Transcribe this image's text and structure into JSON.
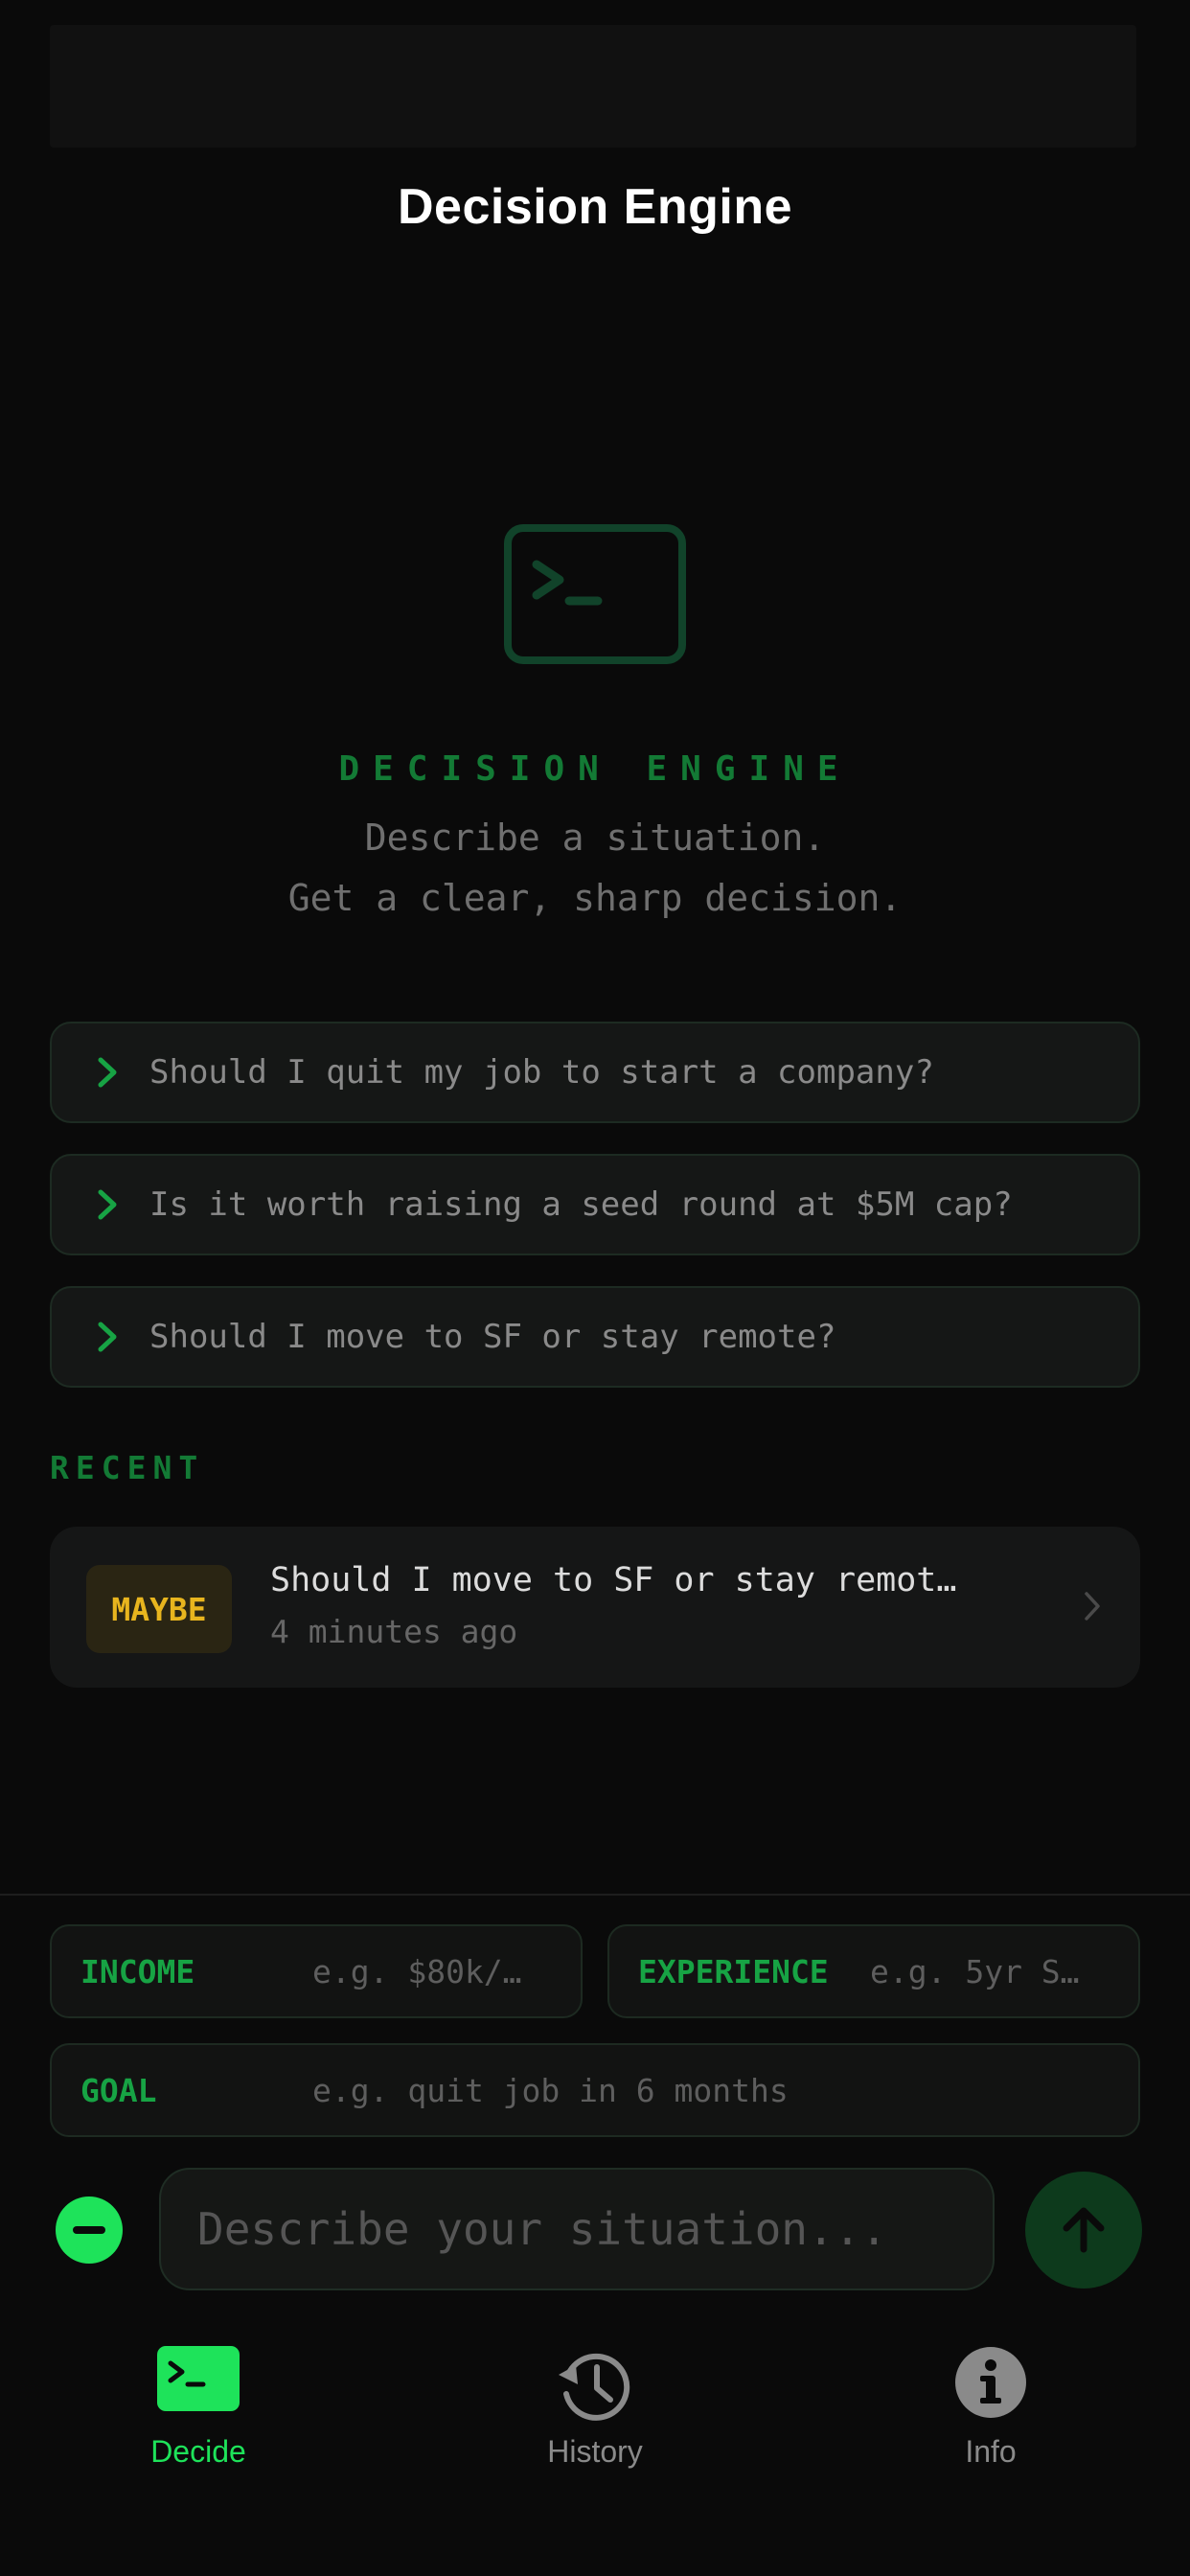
{
  "header": {
    "title": "Decision Engine"
  },
  "hero": {
    "icon": "terminal-icon",
    "heading": "DECISION ENGINE",
    "subtitle_line1": "Describe a situation.",
    "subtitle_line2": "Get a clear, sharp decision."
  },
  "suggestions": [
    {
      "text": "Should I quit my job to start a company?"
    },
    {
      "text": "Is it worth raising a seed round at $5M cap?"
    },
    {
      "text": "Should I move to SF or stay remote?"
    }
  ],
  "recent": {
    "label": "RECENT",
    "items": [
      {
        "verdict": "MAYBE",
        "title": "Should I move to SF or stay remot…",
        "time": "4 minutes ago"
      }
    ]
  },
  "context_fields": {
    "income": {
      "label": "INCOME",
      "placeholder": "e.g. $80k/…"
    },
    "experience": {
      "label": "EXPERIENCE",
      "placeholder": "e.g. 5yr S…"
    },
    "goal": {
      "label": "GOAL",
      "placeholder": "e.g. quit job in 6 months"
    }
  },
  "composer": {
    "placeholder": "Describe your situation...",
    "minus_icon": "minus-circle-icon",
    "send_icon": "arrow-up-icon"
  },
  "tabs": [
    {
      "label": "Decide",
      "icon": "terminal-icon",
      "active": true
    },
    {
      "label": "History",
      "icon": "history-clock-icon",
      "active": false
    },
    {
      "label": "Info",
      "icon": "info-icon",
      "active": false
    }
  ],
  "colors": {
    "accent": "#1ee35a",
    "accent_dim": "#137a35",
    "maybe": "#e8b51e",
    "background": "#0a0a0a"
  }
}
